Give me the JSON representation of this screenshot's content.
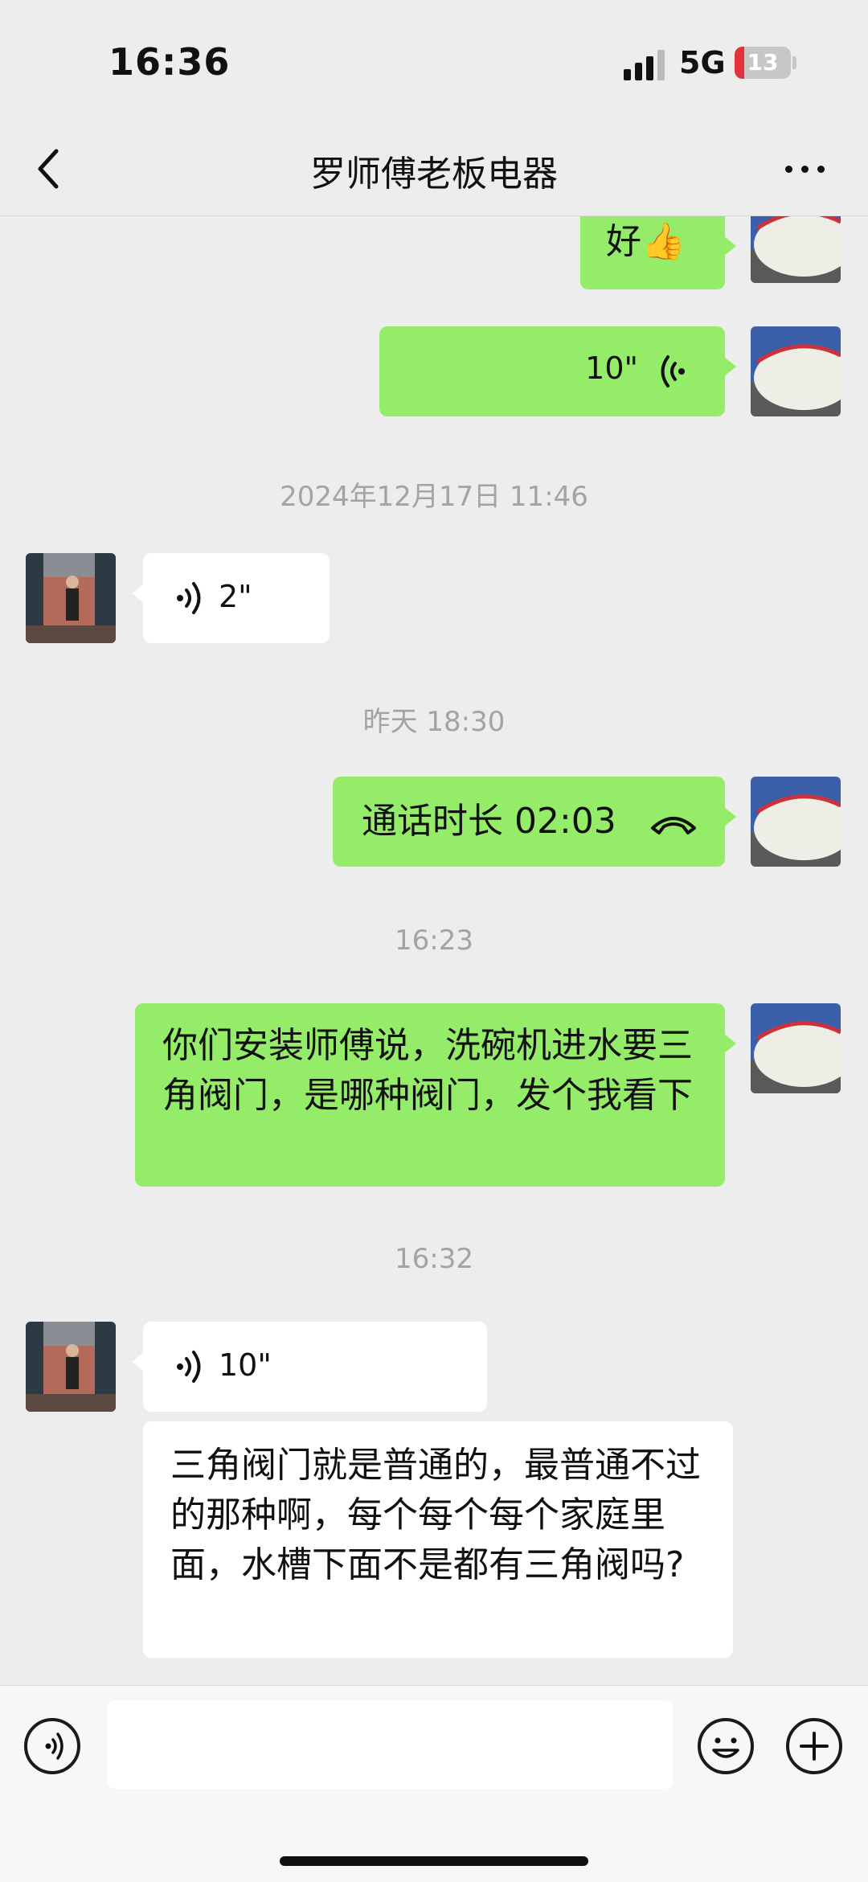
{
  "status_bar": {
    "time": "16:36",
    "network": "5G",
    "battery": "13",
    "battery_color": "#e5323a"
  },
  "header": {
    "title": "罗师傅老板电器",
    "back_icon": "chevron-left-icon",
    "more_icon": "more-dots-icon"
  },
  "messages": {
    "m1": {
      "text": "好👍"
    },
    "m2": {
      "duration": "10\""
    },
    "ts1": "2024年12月17日 11:46",
    "m3": {
      "duration": "2\""
    },
    "ts2": "昨天 18:30",
    "m4": {
      "text": "通话时长 02:03"
    },
    "ts3": "16:23",
    "m5": {
      "text": "你们安装师傅说，洗碗机进水要三角阀门，是哪种阀门，发个我看下"
    },
    "ts4": "16:32",
    "m6": {
      "duration": "10\""
    },
    "m7": {
      "text": "三角阀门就是普通的，最普通不过的那种啊，每个每个每个家庭里面，水槽下面不是都有三角阀吗?"
    }
  },
  "input_bar": {
    "voice_icon": "voice-input-icon",
    "emoji_icon": "emoji-icon",
    "plus_icon": "plus-icon"
  },
  "colors": {
    "sent_bubble": "#95ec69",
    "received_bubble": "#ffffff",
    "background": "#ededed"
  }
}
